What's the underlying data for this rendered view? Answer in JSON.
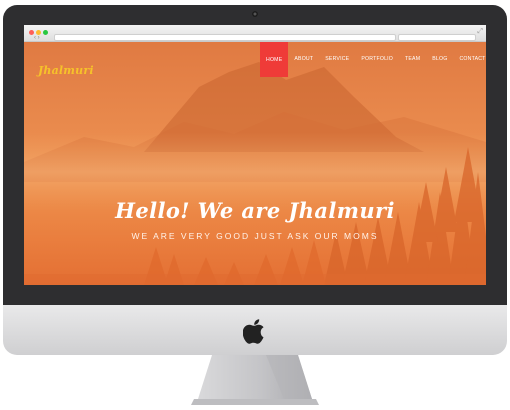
{
  "site": {
    "logo": "Jhalmuri",
    "nav": [
      "HOME",
      "ABOUT",
      "SERVICE",
      "PORTFOLIO",
      "TEAM",
      "BLOG",
      "CONTACT"
    ],
    "active_nav": "HOME"
  },
  "hero": {
    "title": "Hello! We are Jhalmuri",
    "subtitle": "WE ARE VERY GOOD JUST ASK OUR MOMS"
  },
  "colors": {
    "accent": "#ef3b38",
    "logo": "#f6c22a",
    "hero_overlay": "#e98a4d",
    "bezel": "#2e2e30"
  }
}
